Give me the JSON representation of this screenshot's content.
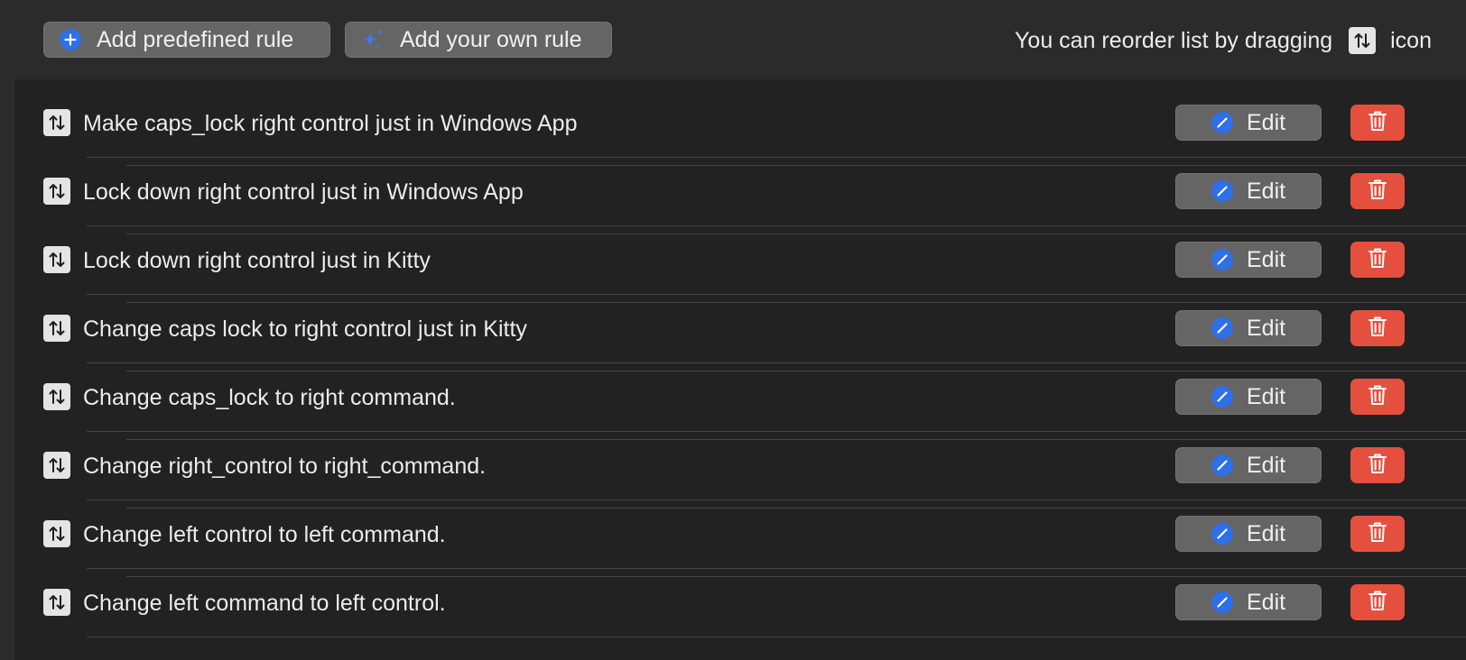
{
  "toolbar": {
    "add_predefined_label": "Add predefined rule",
    "add_predefined_icon": "plus-circle-icon",
    "add_own_label": "Add your own rule",
    "add_own_icon": "sparkles-icon"
  },
  "hint": {
    "before": "You can reorder list by dragging",
    "icon": "reorder-arrows-icon",
    "after": "icon"
  },
  "edit_label": "Edit",
  "rules": [
    {
      "label": "Make caps_lock right control just in Windows App"
    },
    {
      "label": "Lock down right control just in Windows App"
    },
    {
      "label": "Lock down right control just in Kitty"
    },
    {
      "label": "Change caps lock to right control just in Kitty"
    },
    {
      "label": "Change caps_lock to right command."
    },
    {
      "label": "Change right_control to right_command."
    },
    {
      "label": "Change left control to left command."
    },
    {
      "label": "Change left command to left control."
    }
  ],
  "colors": {
    "background": "#2b2b2b",
    "list_background": "#222222",
    "button": "#656565",
    "accent_blue": "#2f6fe8",
    "delete_red": "#e5503e"
  }
}
